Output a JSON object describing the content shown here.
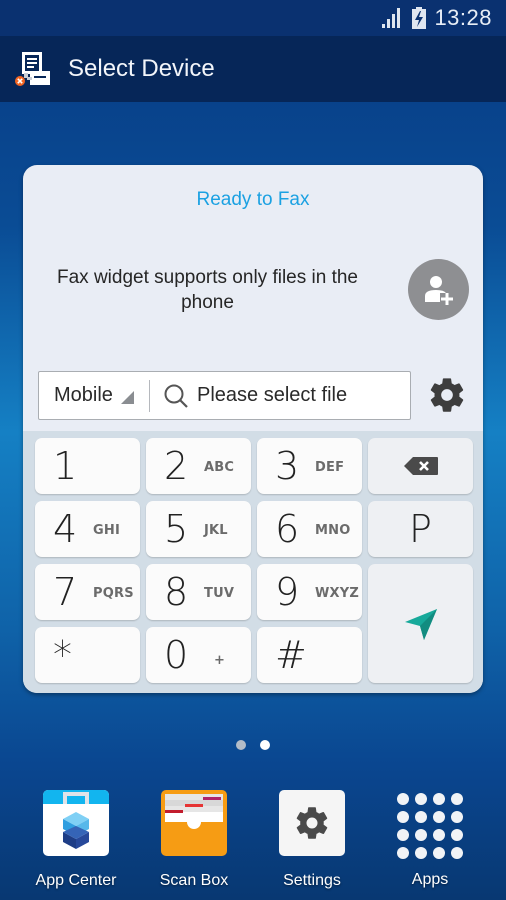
{
  "status_bar": {
    "time": "13:28",
    "signal_icon": "signal-bars-icon",
    "battery_icon": "battery-charging-icon"
  },
  "title_bar": {
    "title": "Select Device",
    "app_icon": "printer-disconnected-icon"
  },
  "widget": {
    "status": "Ready to Fax",
    "info": "Fax widget supports only files in the phone",
    "add_contact_icon": "add-contact-icon",
    "recipient_type": "Mobile",
    "file_search_placeholder": "Please select file",
    "settings_icon": "gear-icon",
    "colors": {
      "status": "#1ba1e2",
      "send": "#17a99a"
    }
  },
  "keypad": {
    "keys": [
      {
        "num": "1",
        "letters": ""
      },
      {
        "num": "2",
        "letters": "ABC"
      },
      {
        "num": "3",
        "letters": "DEF"
      },
      {
        "num": "4",
        "letters": "GHI"
      },
      {
        "num": "5",
        "letters": "JKL"
      },
      {
        "num": "6",
        "letters": "MNO"
      },
      {
        "num": "7",
        "letters": "PQRS"
      },
      {
        "num": "8",
        "letters": "TUV"
      },
      {
        "num": "9",
        "letters": "WXYZ"
      },
      {
        "num": "*",
        "letters": ""
      },
      {
        "num": "0",
        "letters": "+"
      },
      {
        "num": "#",
        "letters": ""
      }
    ],
    "pause_key": "P",
    "backspace_icon": "backspace-icon",
    "send_icon": "send-icon"
  },
  "home": {
    "page_indicator": {
      "count": 2,
      "active_index": 1
    },
    "dock": [
      {
        "label": "App Center",
        "icon": "app-center-icon"
      },
      {
        "label": "Scan Box",
        "icon": "scan-box-icon"
      },
      {
        "label": "Settings",
        "icon": "settings-app-icon"
      },
      {
        "label": "Apps",
        "icon": "apps-grid-icon"
      }
    ]
  }
}
